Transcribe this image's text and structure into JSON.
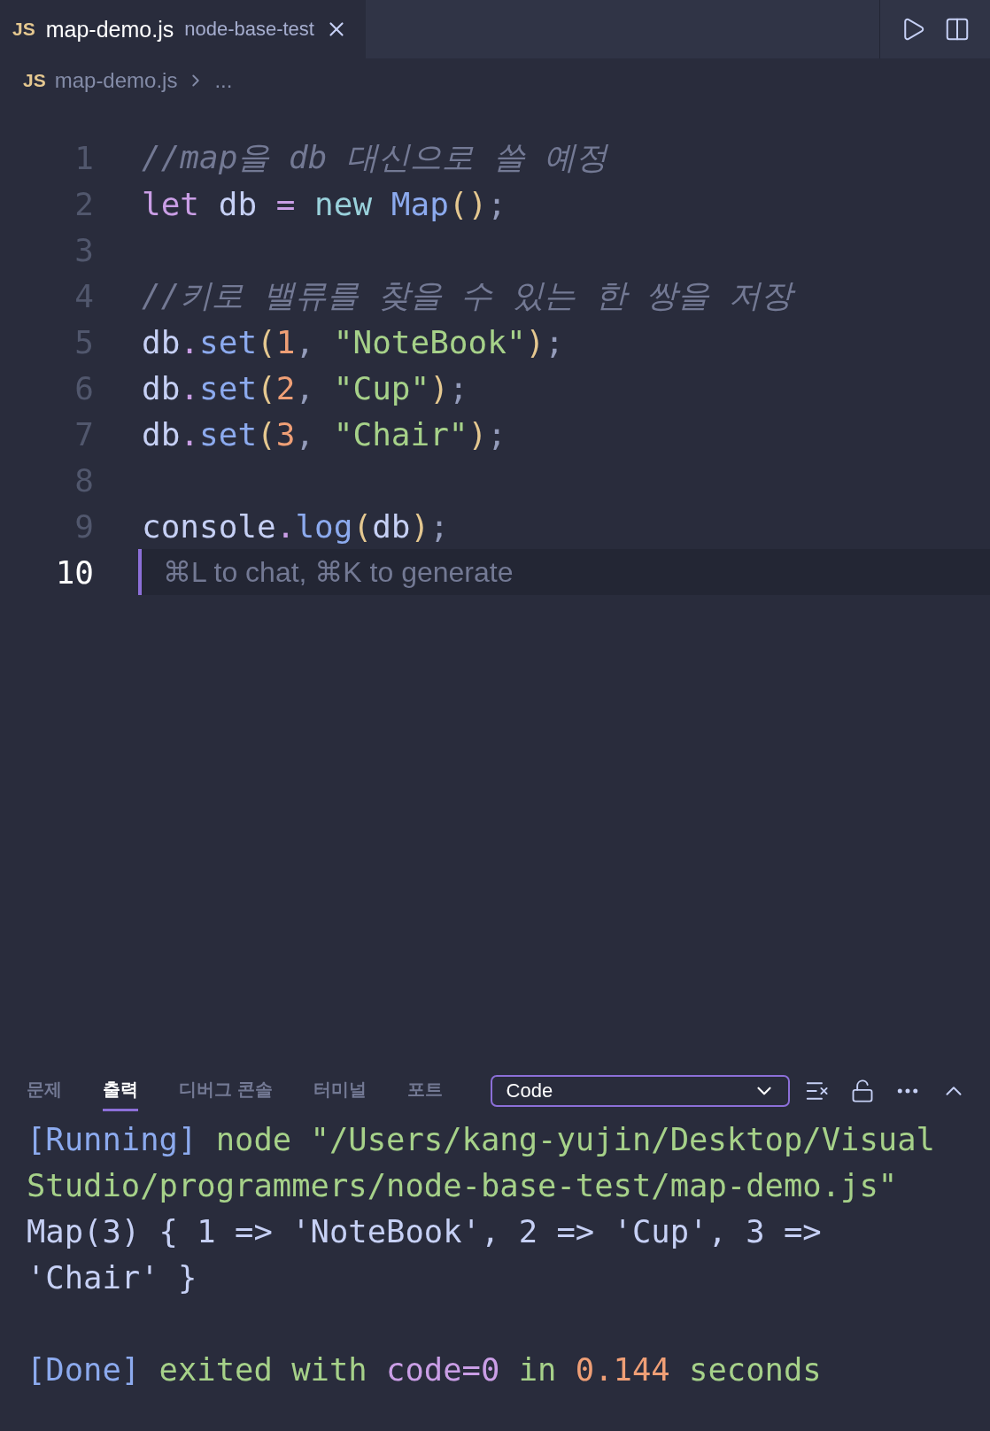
{
  "tabs": [
    {
      "badge": "JS",
      "title": "map-demo.js",
      "description": "node-base-test",
      "selected": true
    }
  ],
  "breadcrumb": {
    "badge": "JS",
    "items": [
      "map-demo.js",
      "..."
    ]
  },
  "editor": {
    "lines": [
      {
        "number": "1",
        "current": false,
        "tokens": [
          {
            "text": "//map을 db 대신으로 쓸 예정",
            "kind": "comment"
          }
        ]
      },
      {
        "number": "2",
        "current": false,
        "tokens": [
          {
            "text": "let ",
            "kind": "keyword"
          },
          {
            "text": "db ",
            "kind": "plain"
          },
          {
            "text": "= ",
            "kind": "operator"
          },
          {
            "text": "new ",
            "kind": "new"
          },
          {
            "text": "Map",
            "kind": "function"
          },
          {
            "text": "()",
            "kind": "paren"
          },
          {
            "text": ";",
            "kind": "punct"
          }
        ]
      },
      {
        "number": "3",
        "current": false
      },
      {
        "number": "4",
        "current": false,
        "tokens": [
          {
            "text": "//키로 밸류를 찾을 수 있는 한 쌍을 저장",
            "kind": "comment"
          }
        ]
      },
      {
        "number": "5",
        "current": false,
        "tokens": [
          {
            "text": "db",
            "kind": "plain"
          },
          {
            "text": ".",
            "kind": "operator"
          },
          {
            "text": "set",
            "kind": "function"
          },
          {
            "text": "(",
            "kind": "paren"
          },
          {
            "text": "1",
            "kind": "number"
          },
          {
            "text": ", ",
            "kind": "punct"
          },
          {
            "text": "\"NoteBook\"",
            "kind": "string"
          },
          {
            "text": ")",
            "kind": "paren"
          },
          {
            "text": ";",
            "kind": "punct"
          }
        ]
      },
      {
        "number": "6",
        "current": false,
        "tokens": [
          {
            "text": "db",
            "kind": "plain"
          },
          {
            "text": ".",
            "kind": "operator"
          },
          {
            "text": "set",
            "kind": "function"
          },
          {
            "text": "(",
            "kind": "paren"
          },
          {
            "text": "2",
            "kind": "number"
          },
          {
            "text": ", ",
            "kind": "punct"
          },
          {
            "text": "\"Cup\"",
            "kind": "string"
          },
          {
            "text": ")",
            "kind": "paren"
          },
          {
            "text": ";",
            "kind": "punct"
          }
        ]
      },
      {
        "number": "7",
        "current": false,
        "tokens": [
          {
            "text": "db",
            "kind": "plain"
          },
          {
            "text": ".",
            "kind": "operator"
          },
          {
            "text": "set",
            "kind": "function"
          },
          {
            "text": "(",
            "kind": "paren"
          },
          {
            "text": "3",
            "kind": "number"
          },
          {
            "text": ", ",
            "kind": "punct"
          },
          {
            "text": "\"Chair\"",
            "kind": "string"
          },
          {
            "text": ")",
            "kind": "paren"
          },
          {
            "text": ";",
            "kind": "punct"
          }
        ]
      },
      {
        "number": "8",
        "current": false
      },
      {
        "number": "9",
        "current": false,
        "tokens": [
          {
            "text": "console",
            "kind": "plain"
          },
          {
            "text": ".",
            "kind": "operator"
          },
          {
            "text": "log",
            "kind": "function"
          },
          {
            "text": "(",
            "kind": "paren"
          },
          {
            "text": "db",
            "kind": "plain"
          },
          {
            "text": ")",
            "kind": "paren"
          },
          {
            "text": ";",
            "kind": "punct"
          }
        ]
      },
      {
        "number": "10",
        "current": true,
        "hint": "⌘L to chat, ⌘K to generate"
      }
    ]
  },
  "panel": {
    "tabs": [
      {
        "label": "문제",
        "selected": false
      },
      {
        "label": "출력",
        "selected": true
      },
      {
        "label": "디버그 콘솔",
        "selected": false
      },
      {
        "label": "터미널",
        "selected": false
      },
      {
        "label": "포트",
        "selected": false
      }
    ],
    "channel": "Code",
    "output": [
      [
        {
          "tokens": [
            {
              "text": "[Running]",
              "kind": "tag"
            },
            {
              "text": " node \"/Users/kang-yujin/Desktop/Visual",
              "kind": "string"
            }
          ]
        },
        {
          "tokens": [
            {
              "text": "Studio/programmers/node-base-test/map-demo.js\"",
              "kind": "string"
            }
          ]
        },
        {
          "tokens": [
            {
              "text": "Map(3) { 1 => 'NoteBook', 2 => 'Cup', 3 =>",
              "kind": "plain"
            }
          ]
        },
        {
          "tokens": [
            {
              "text": "'Chair' }",
              "kind": "plain"
            }
          ]
        }
      ],
      [
        {
          "tokens": [
            {
              "text": "[Done]",
              "kind": "tag"
            },
            {
              "text": " exited with ",
              "kind": "string"
            },
            {
              "text": "code=0",
              "kind": "keyword"
            },
            {
              "text": " in ",
              "kind": "string"
            },
            {
              "text": "0.144",
              "kind": "number"
            },
            {
              "text": " seconds",
              "kind": "string"
            }
          ]
        }
      ]
    ]
  }
}
